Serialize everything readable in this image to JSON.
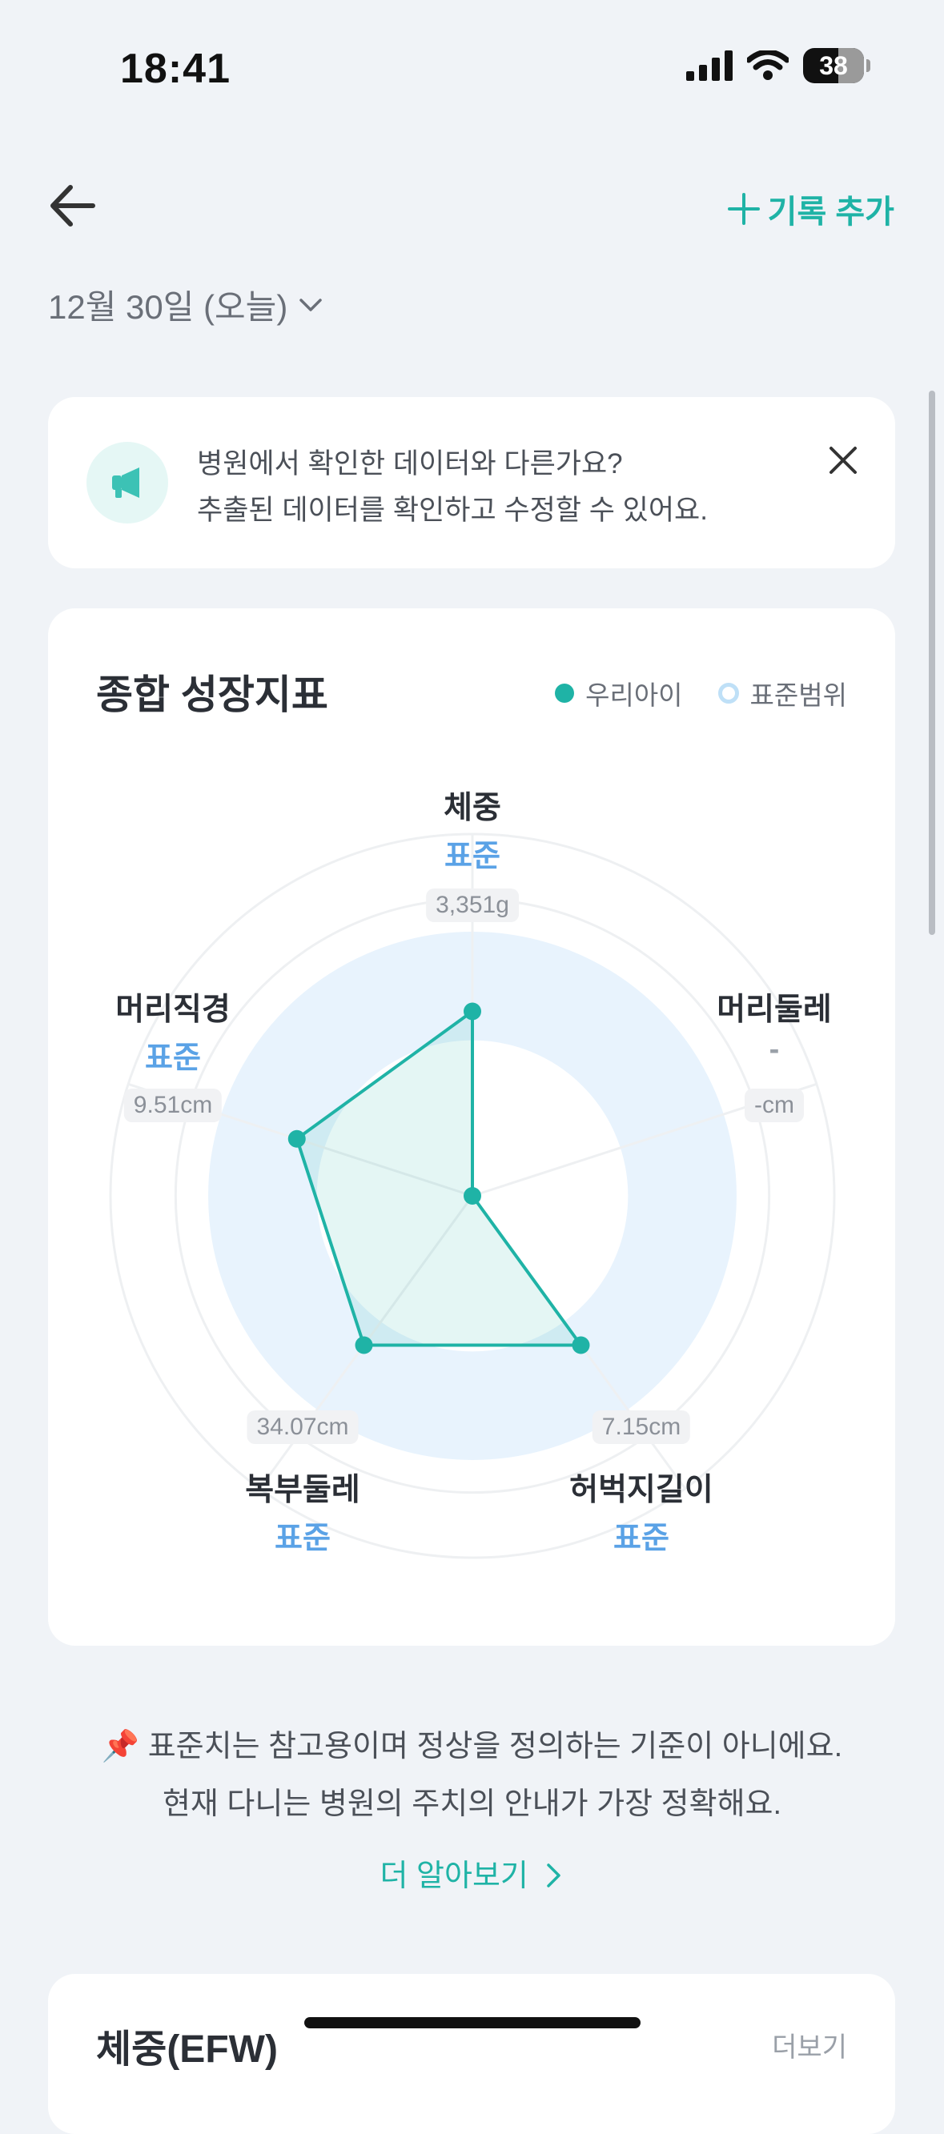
{
  "status_bar": {
    "time": "18:41",
    "battery": "38"
  },
  "header": {
    "add_record_label": "기록 추가",
    "date_label": "12월 30일 (오늘)"
  },
  "notice": {
    "line1": "병원에서 확인한 데이터와 다른가요?",
    "line2": "추출된 데이터를 확인하고 수정할 수 있어요."
  },
  "growth_card": {
    "title": "종합 성장지표",
    "legend": {
      "ours": "우리아이",
      "standard": "표준범위"
    },
    "axes": [
      {
        "name": "체중",
        "status": "표준",
        "value": "3,351g"
      },
      {
        "name": "머리둘레",
        "status": "-",
        "value": "-cm"
      },
      {
        "name": "허벅지길이",
        "status": "표준",
        "value": "7.15cm"
      },
      {
        "name": "복부둘레",
        "status": "표준",
        "value": "34.07cm"
      },
      {
        "name": "머리직경",
        "status": "표준",
        "value": "9.51cm"
      }
    ]
  },
  "chart_data": {
    "type": "radar",
    "categories": [
      "체중",
      "머리둘레",
      "허벅지길이",
      "복부둘레",
      "머리직경"
    ],
    "series": [
      {
        "name": "우리아이",
        "values": [
          0.51,
          0,
          0.51,
          0.51,
          0.51
        ]
      }
    ],
    "standard_range": [
      0.43,
      0.73
    ],
    "range": [
      0,
      1
    ]
  },
  "disclaimer": {
    "line1": "📌 표준치는 참고용이며 정상을 정의하는 기준이 아니에요.",
    "line2": "현재 다니는 병원의 주치의 안내가 가장 정확해요.",
    "learn_more": "더 알아보기"
  },
  "bottom_card": {
    "title": "체중(EFW)",
    "more": "더보기"
  },
  "colors": {
    "accent": "#1fb3a6",
    "standard": "#5aa2e6",
    "range_band": "#e8f3fd",
    "background": "#f0f3f7"
  }
}
